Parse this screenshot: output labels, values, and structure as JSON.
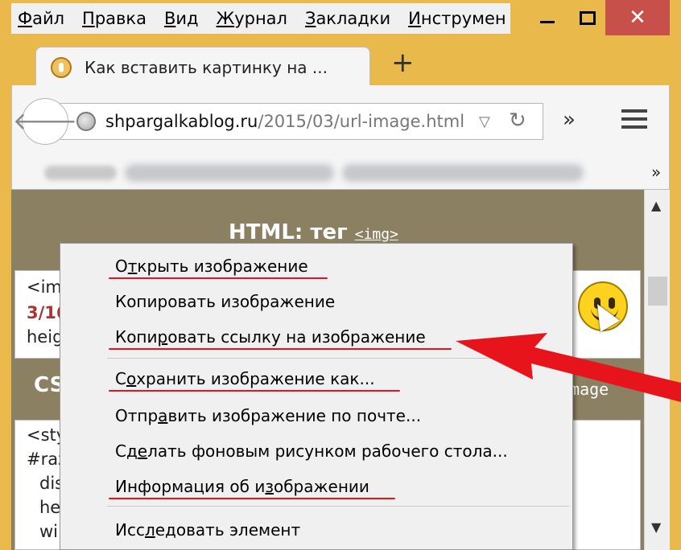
{
  "menubar": {
    "items": [
      {
        "pre": "",
        "u": "Ф",
        "post": "айл"
      },
      {
        "pre": "",
        "u": "П",
        "post": "равка"
      },
      {
        "pre": "",
        "u": "В",
        "post": "ид"
      },
      {
        "pre": "",
        "u": "Ж",
        "post": "урнал"
      },
      {
        "pre": "",
        "u": "З",
        "post": "акладки"
      },
      {
        "pre": "",
        "u": "И",
        "post": "нструмен"
      }
    ]
  },
  "window_controls": {
    "minimize_icon": "minimize-icon",
    "maximize_icon": "maximize-icon",
    "close_icon": "close-icon",
    "close_glyph": "✕"
  },
  "tab": {
    "title": "Как вставить картинку на ...",
    "favicon": "site-favicon",
    "new_tab": "+"
  },
  "navbar": {
    "back_glyph": "🡐",
    "url_host": "shpargalkablog.ru",
    "url_path": "/2015/03/url-image.html",
    "dropdown_glyph": "▽",
    "reload_glyph": "↻",
    "overflow_glyph": "»"
  },
  "bookmarks": {
    "more_glyph": "»"
  },
  "page": {
    "heading_text": "HTML: тег ",
    "heading_code": "<img>",
    "box1_line1": "<im",
    "box1_line2": "3/16",
    "box1_line3": "heig",
    "cs_label": "CS",
    "image_label": "image",
    "box2_lines": [
      "<sty",
      "#raz",
      "  dis",
      "  he",
      "  wi"
    ]
  },
  "scrollbar": {
    "up": "▲",
    "down": "▼"
  },
  "context_menu": {
    "items": [
      {
        "pre": "О",
        "u": "т",
        "post": "крыть изображение"
      },
      {
        "pre": "Копировать изображение",
        "u": "",
        "post": ""
      },
      {
        "pre": "Копи",
        "u": "р",
        "post": "овать ссылку на изображение"
      },
      {
        "pre": "С",
        "u": "о",
        "post": "хранить изображение как..."
      },
      {
        "pre": "Отпр",
        "u": "а",
        "post": "вить изображение по почте..."
      },
      {
        "pre": "Сд",
        "u": "е",
        "post": "лать фоновым рисунком рабочего стола..."
      },
      {
        "pre": "Информация об и",
        "u": "з",
        "post": "ображении"
      },
      {
        "pre": "Исс",
        "u": "л",
        "post": "едовать элемент"
      }
    ]
  },
  "colors": {
    "frame": "#e9b94c",
    "annotation_red": "#e8141b",
    "content_bg": "#8c8062"
  }
}
